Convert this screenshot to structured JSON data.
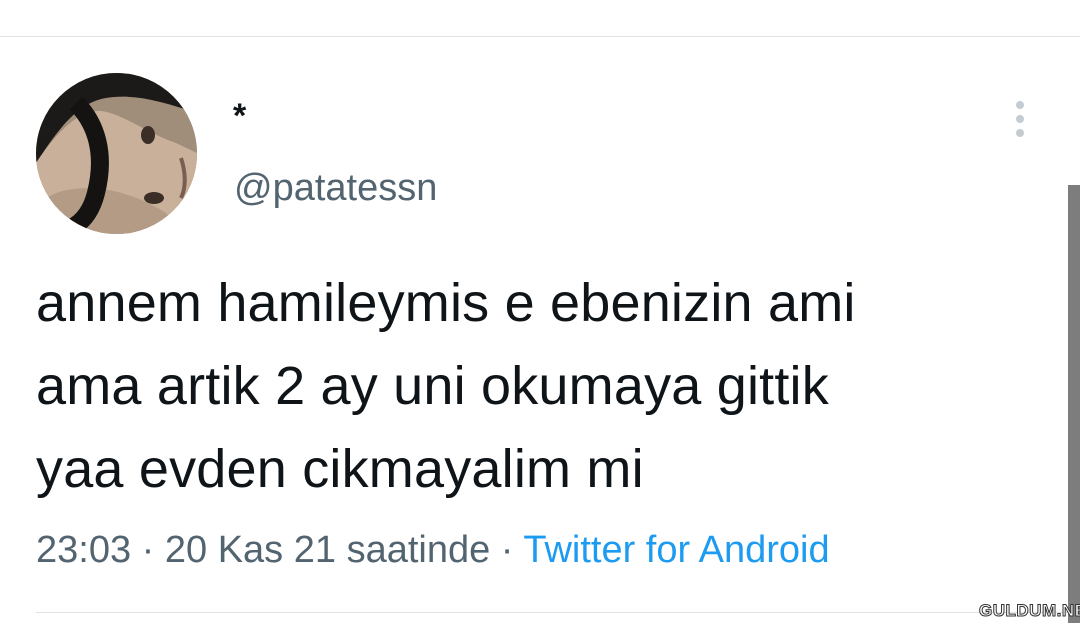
{
  "tweet": {
    "display_name": "*",
    "handle": "@patatessn",
    "text_lines": [
      "annem hamileymis e ebenizin ami",
      "ama artik 2 ay uni okumaya gittik",
      "yaa evden cikmayalim mi"
    ],
    "time": "23:03",
    "separator_1": " · ",
    "date": "20 Kas 21 saatinde",
    "separator_2": " · ",
    "source": "Twitter for Android"
  },
  "icons": {
    "more": "more-vertical-icon",
    "avatar": "profile-photo"
  },
  "watermark": "GULDUM.NET",
  "colors": {
    "text": "#0f1419",
    "secondary": "#536471",
    "link": "#1d9bf0",
    "divider": "#dfe3e6"
  }
}
